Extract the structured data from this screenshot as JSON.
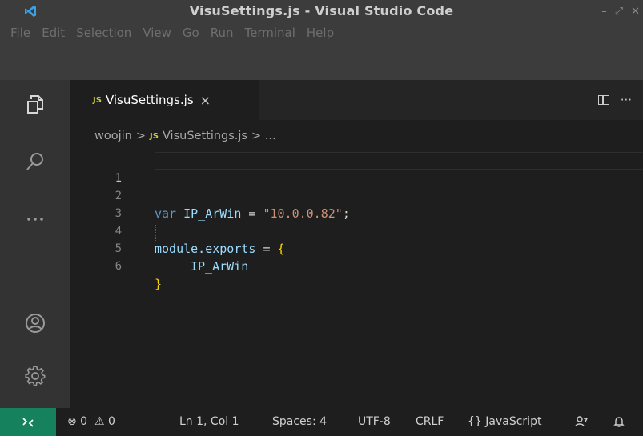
{
  "window": {
    "title": "VisuSettings.js - Visual Studio Code",
    "controls": [
      "–",
      "⤢",
      "✕"
    ]
  },
  "menu": [
    "File",
    "Edit",
    "Selection",
    "View",
    "Go",
    "Run",
    "Terminal",
    "Help"
  ],
  "activity_bar": [
    "explorer-icon",
    "search-icon",
    "more-icon",
    "account-icon",
    "manage-gear-icon"
  ],
  "tab": {
    "badge": "JS",
    "label": "VisuSettings.js",
    "close": "×",
    "more": "···"
  },
  "breadcrumb": {
    "folder": "woojin",
    "sep": ">",
    "badge": "JS",
    "file": "VisuSettings.js",
    "tail": "> ..."
  },
  "editor": {
    "line_numbers": [
      "1",
      "2",
      "3",
      "4",
      "5",
      "6"
    ],
    "line2": {
      "kw": "var",
      "name": "IP_ArWin",
      "eq": " = ",
      "str": "\"10.0.0.82\"",
      "end": ";"
    },
    "line4": {
      "name": "module.exports",
      "eq": " = ",
      "brace": "{"
    },
    "line5": {
      "name": "IP_ArWin"
    },
    "line6": {
      "brace": "}"
    }
  },
  "status": {
    "errors": "⊗ 0",
    "warnings": "⚠ 0",
    "cursor": "Ln 1, Col 1",
    "spaces": "Spaces: 4",
    "encoding": "UTF-8",
    "eol": "CRLF",
    "language": "{} JavaScript"
  },
  "colors": {
    "titlebar": "#3c3c3c",
    "activitybar": "#333333",
    "editor": "#1e1e1e",
    "remote": "#16825d",
    "js_badge": "#cbcb41"
  }
}
